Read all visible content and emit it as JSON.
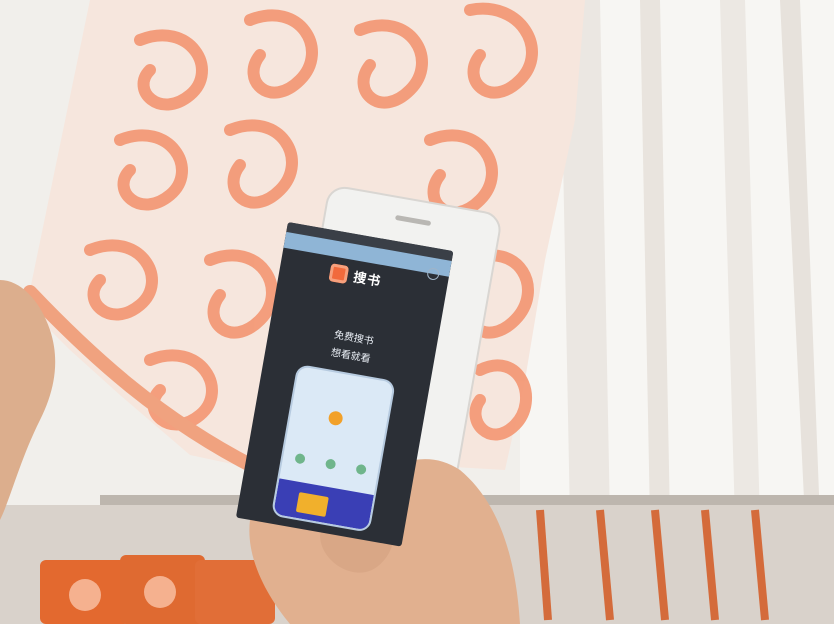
{
  "phone": {
    "app_name": "搜书",
    "tagline_line1": "免费搜书",
    "tagline_line2": "想看就看"
  },
  "colors": {
    "curtain_orange": "#f39a77",
    "curtain_white": "#f5f3ef",
    "phone_body": "#f2f2f0",
    "screen_dark": "#2b2f36",
    "app_accent": "#f16a3c"
  },
  "icons": [
    "app-logo-icon",
    "help-icon"
  ]
}
